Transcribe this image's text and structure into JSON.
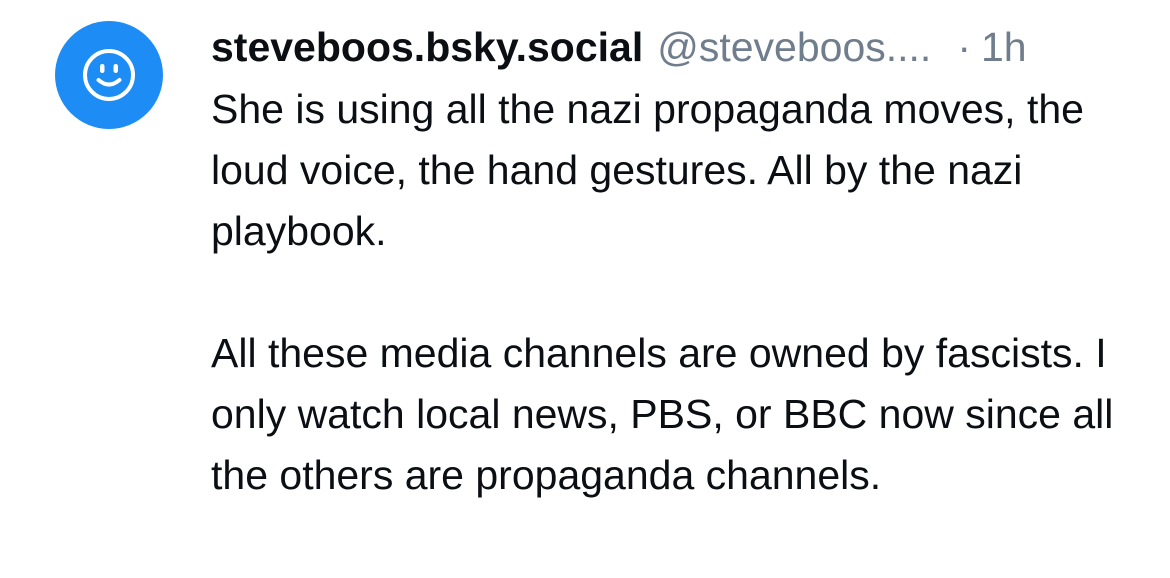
{
  "post": {
    "avatar_icon": "smiley-face-icon",
    "avatar_color": "#1d8cf5",
    "display_name": "steveboos.bsky.social",
    "handle": "@steveboos....",
    "separator": "·",
    "timestamp": "1h",
    "paragraphs": [
      "She is using all the nazi propaganda moves, the loud voice, the hand gestures. All by the nazi playbook.",
      "All these media channels are owned by fascists. I only watch local news, PBS, or BBC now since all the others are propaganda channels."
    ]
  }
}
